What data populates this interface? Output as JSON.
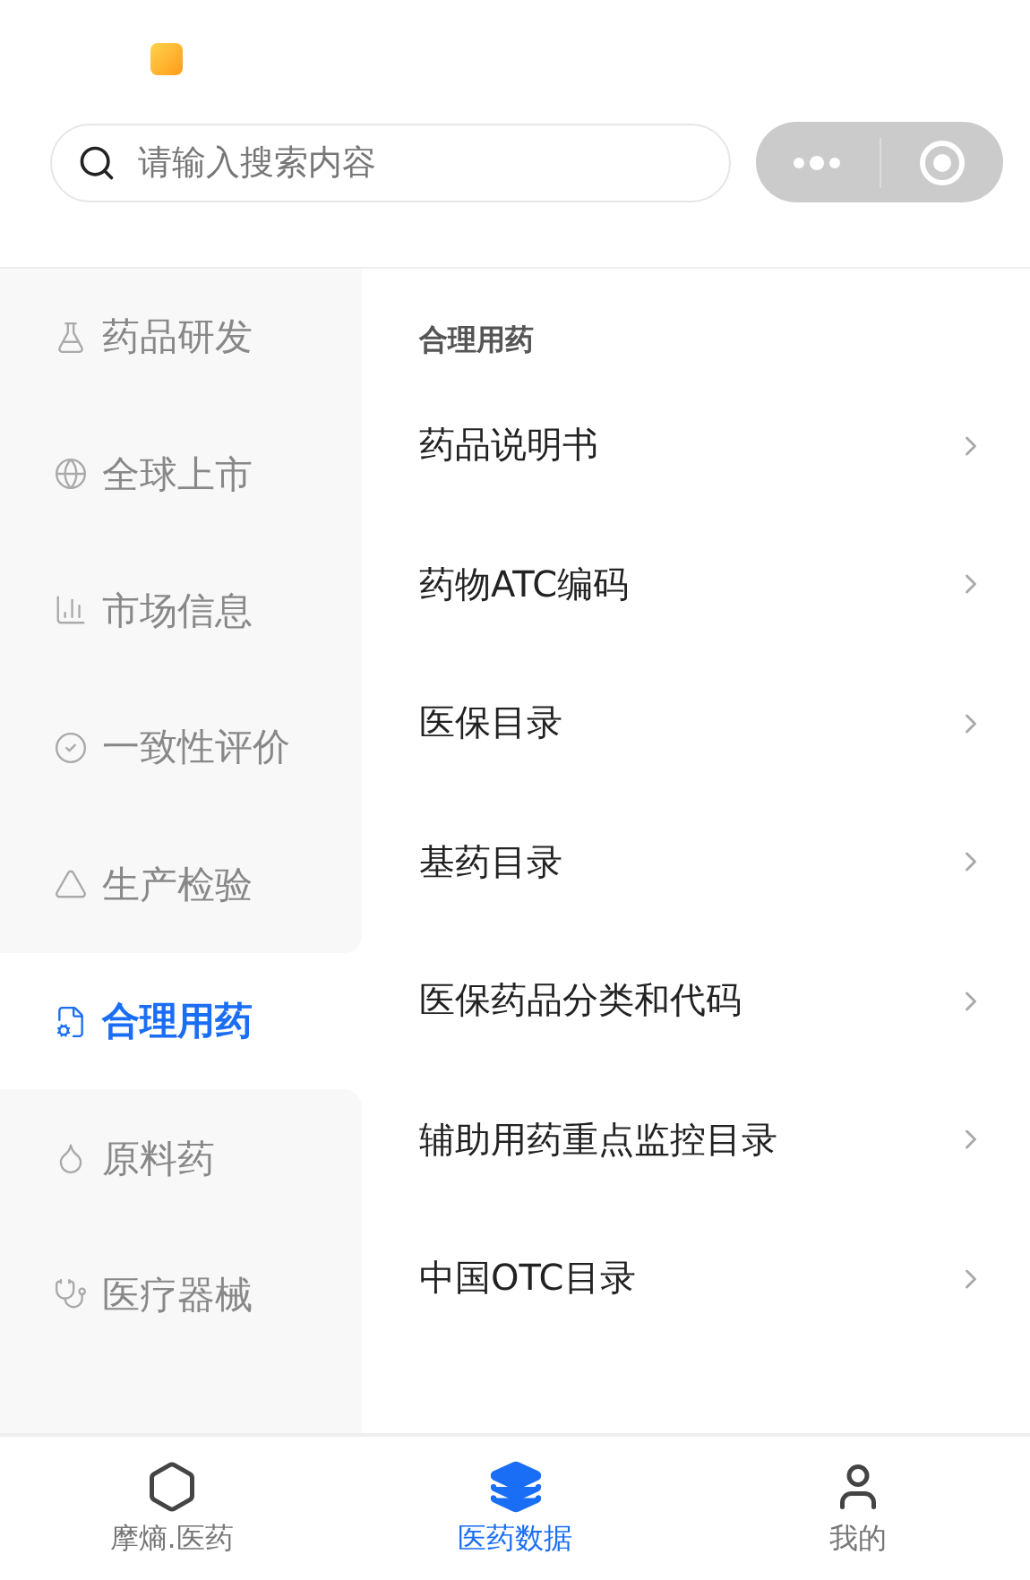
{
  "search": {
    "placeholder": "请输入搜索内容"
  },
  "sidebar": {
    "items": [
      {
        "label": "药品研发",
        "selected": false
      },
      {
        "label": "全球上市",
        "selected": false
      },
      {
        "label": "市场信息",
        "selected": false
      },
      {
        "label": "一致性评价",
        "selected": false
      },
      {
        "label": "生产检验",
        "selected": false
      },
      {
        "label": "合理用药",
        "selected": true
      },
      {
        "label": "原料药",
        "selected": false
      },
      {
        "label": "医疗器械",
        "selected": false
      }
    ]
  },
  "content": {
    "section_title": "合理用药",
    "items": [
      "药品说明书",
      "药物ATC编码",
      "医保目录",
      "基药目录",
      "医保药品分类和代码",
      "辅助用药重点监控目录",
      "中国OTC目录"
    ]
  },
  "tab_bar": [
    {
      "label": "摩熵.医药",
      "selected": false
    },
    {
      "label": "医药数据",
      "selected": true
    },
    {
      "label": "我的",
      "selected": false
    }
  ]
}
